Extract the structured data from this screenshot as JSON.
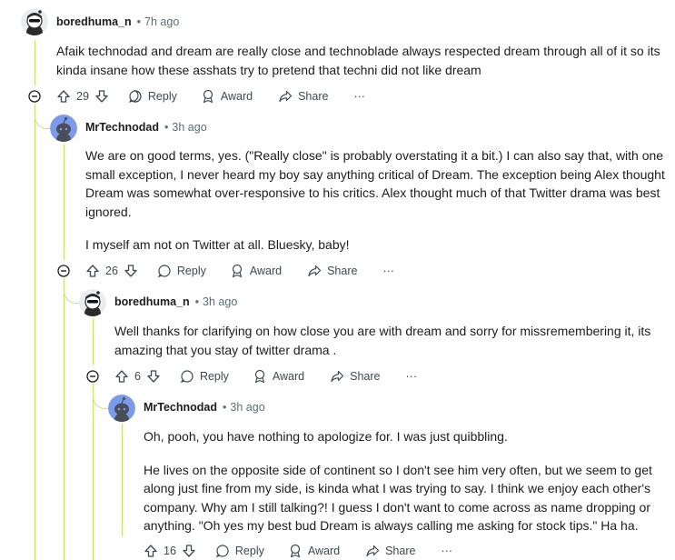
{
  "comments": [
    {
      "author": "boredhuma_n",
      "time": "7h ago",
      "paragraphs": [
        "Afaik technodad and dream are really close and technoblade always respected dream through all of it so its kinda insane how these asshats try to pretend that techni did not like dream"
      ],
      "votes": "29",
      "actions": {
        "reply": "Reply",
        "award": "Award",
        "share": "Share",
        "more": "···"
      }
    },
    {
      "author": "MrTechnodad",
      "time": "3h ago",
      "paragraphs": [
        "We are on good terms, yes. (\"Really close\" is probably overstating it a bit.) I can also say that, with one small exception, I never heard my boy say anything critical of Dream. The exception being Alex thought Dream was somewhat over-responsive to his critics. Alex thought much of that Twitter drama was best ignored.",
        "I myself am not on Twitter at all. Bluesky, baby!"
      ],
      "votes": "26",
      "actions": {
        "reply": "Reply",
        "award": "Award",
        "share": "Share",
        "more": "···"
      }
    },
    {
      "author": "boredhuma_n",
      "time": "3h ago",
      "paragraphs": [
        "Well thanks for clarifying on how close you are with dream and sorry for missremembering it, its amazing that you stay of twitter drama ."
      ],
      "votes": "6",
      "actions": {
        "reply": "Reply",
        "award": "Award",
        "share": "Share",
        "more": "···"
      }
    },
    {
      "author": "MrTechnodad",
      "time": "3h ago",
      "paragraphs": [
        "Oh, pooh, you have nothing to apologize for. I was just quibbling.",
        "He lives on the opposite side of continent so I don't see him very often, but we seem to get along just fine from my side, is kinda what I was trying to say. I think we enjoy each other's company. Why am I still talking?! I guess I don't want to come across as name dropping or anything. \"Oh yes my best bud Dream is always calling me asking for stock tips.\" Ha ha."
      ],
      "votes": "16",
      "actions": {
        "reply": "Reply",
        "award": "Award",
        "share": "Share",
        "more": "···"
      }
    }
  ],
  "colors": {
    "thread_line": "#c2e66a",
    "avatar_blue": "#7b9bea",
    "meta_text": "#576f76",
    "action_text": "#3b4a50"
  },
  "icons": [
    "upvote-icon",
    "downvote-icon",
    "reply-icon",
    "award-icon",
    "share-icon",
    "collapse-icon"
  ]
}
